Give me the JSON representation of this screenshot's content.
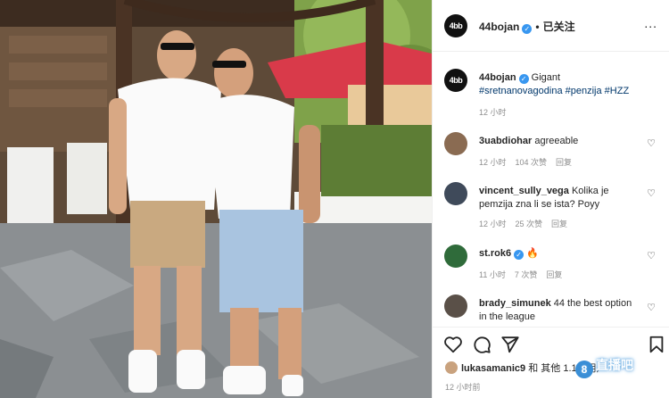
{
  "post_header": {
    "username": "44bojan",
    "separator": "•",
    "follow_status": "已关注",
    "more": "..."
  },
  "caption": {
    "username": "44bojan",
    "text": "Gigant",
    "hashtags": "#sretnanovagodina #penzija #HZZ",
    "time": "12 小时"
  },
  "comments": [
    {
      "username": "3uabdiohar",
      "text": "agreeable",
      "time": "12 小时",
      "likes": "104 次赞",
      "reply": "回复"
    },
    {
      "username": "vincent_sully_vega",
      "text": "Kolika je pemzija zna li se ista? Poyy",
      "time": "12 小时",
      "likes": "25 次赞",
      "reply": "回复"
    },
    {
      "username": "st.rok6",
      "text": "🔥",
      "time": "11 小时",
      "likes": "7 次赞",
      "reply": "回复"
    },
    {
      "username": "brady_simunek",
      "text": "44 the best option in the league",
      "time": "",
      "likes": "",
      "reply": ""
    }
  ],
  "likes_line": {
    "user": "lukasamanic9",
    "text": "和 其他 1.1",
    "suffix": "位用户"
  },
  "post_time": "12 小时前",
  "watermark": {
    "logo": "8",
    "text": "直播吧"
  },
  "icons": {
    "like": "heart-icon",
    "comment": "comment-icon",
    "share": "share-icon",
    "save": "bookmark-icon",
    "verified": "verified-badge-icon"
  },
  "colors": {
    "verified": "#3897f0",
    "hashtag": "#00376b",
    "meta": "#8e8e8e",
    "border": "#efefef"
  }
}
